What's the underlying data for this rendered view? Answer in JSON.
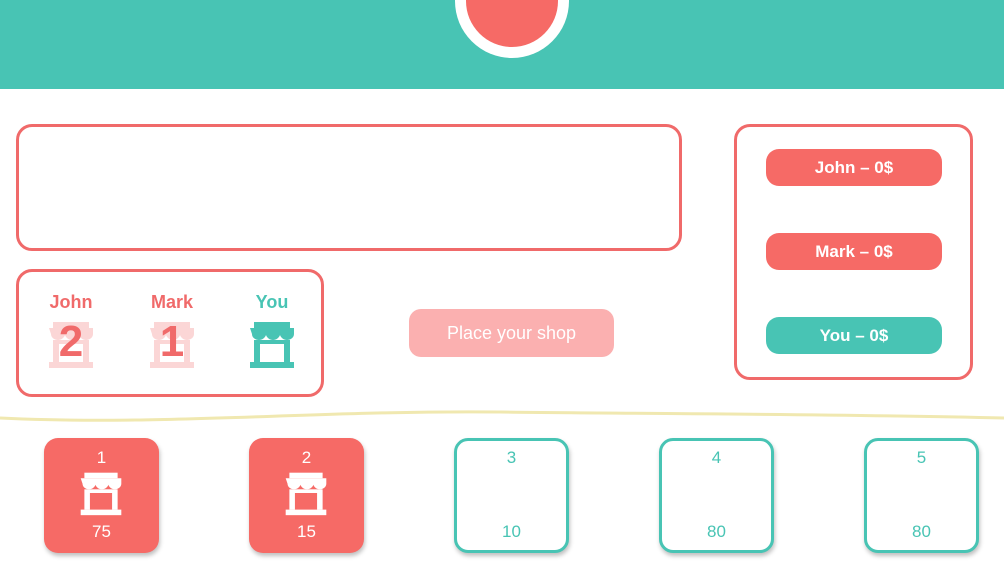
{
  "colors": {
    "teal": "#48c4b4",
    "coral": "#f66a66",
    "coral_light": "#fbb0b0",
    "cream": "#f0e8b0"
  },
  "header": {
    "indicator": "coral-dot"
  },
  "players": [
    {
      "name": "John",
      "shops": "2",
      "color": "#f06a6a"
    },
    {
      "name": "Mark",
      "shops": "1",
      "color": "#f06a6a"
    },
    {
      "name": "You",
      "shops": "",
      "color": "#48c4b4"
    }
  ],
  "action": {
    "place_label": "Place your shop"
  },
  "scores": [
    {
      "label": "John – 0$",
      "color": "#f66a66"
    },
    {
      "label": "Mark – 0$",
      "color": "#f66a66"
    },
    {
      "label": "You – 0$",
      "color": "#48c4b4"
    }
  ],
  "tiles": [
    {
      "number": "1",
      "price": "75",
      "owned": true,
      "icon": "shop-icon"
    },
    {
      "number": "2",
      "price": "15",
      "owned": true,
      "icon": "shop-icon"
    },
    {
      "number": "3",
      "price": "10",
      "owned": false
    },
    {
      "number": "4",
      "price": "80",
      "owned": false
    },
    {
      "number": "5",
      "price": "80",
      "owned": false
    }
  ]
}
